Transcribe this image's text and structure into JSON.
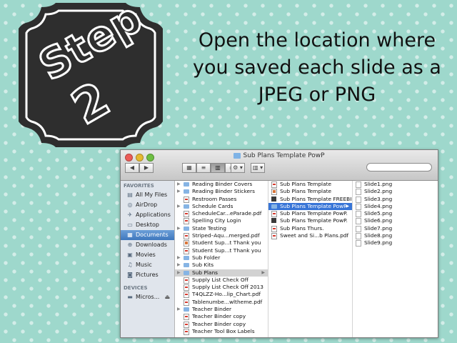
{
  "badge": {
    "line1": "Step",
    "line2": "2"
  },
  "instruction": [
    "Open the location where",
    "you saved each slide as a",
    "JPEG or PNG"
  ],
  "finder": {
    "title": "Sub Plans Template PowP",
    "nav_back": "◀",
    "nav_fwd": "▶",
    "search_placeholder": "",
    "sidebar": {
      "favorites_heading": "FAVORITES",
      "favorites": [
        {
          "label": "All My Files",
          "icon": "all-files-icon",
          "glyph": "▤"
        },
        {
          "label": "AirDrop",
          "icon": "airdrop-icon",
          "glyph": "◎"
        },
        {
          "label": "Applications",
          "icon": "applications-icon",
          "glyph": "✈"
        },
        {
          "label": "Desktop",
          "icon": "desktop-icon",
          "glyph": "▭"
        },
        {
          "label": "Documents",
          "icon": "documents-icon",
          "glyph": "▦",
          "selected": true
        },
        {
          "label": "Downloads",
          "icon": "downloads-icon",
          "glyph": "⊕"
        },
        {
          "label": "Movies",
          "icon": "movies-icon",
          "glyph": "▣"
        },
        {
          "label": "Music",
          "icon": "music-icon",
          "glyph": "♫"
        },
        {
          "label": "Pictures",
          "icon": "pictures-icon",
          "glyph": "◙"
        }
      ],
      "devices_heading": "DEVICES",
      "devices": [
        {
          "label": "Micros...",
          "icon": "disk-icon",
          "glyph": "▬"
        }
      ],
      "eject": "⏏"
    },
    "col1": [
      {
        "label": "Reading Binder Covers",
        "type": "folder",
        "disc": true
      },
      {
        "label": "Reading Binder Stickers",
        "type": "folder",
        "disc": true
      },
      {
        "label": "Restroom Passes",
        "type": "pdf"
      },
      {
        "label": "Schedule Cards",
        "type": "folder",
        "disc": true
      },
      {
        "label": "ScheduleCar...eParade.pdf",
        "type": "pdf"
      },
      {
        "label": "Spelling City Login",
        "type": "pdf"
      },
      {
        "label": "State Testing",
        "type": "folder",
        "disc": true
      },
      {
        "label": "Striped–Aqu...merged.pdf",
        "type": "pdf"
      },
      {
        "label": "Student Sup...t Thank you",
        "type": "ppt"
      },
      {
        "label": "Student Sup...t Thank you",
        "type": "pdf"
      },
      {
        "label": "Sub Folder",
        "type": "folder",
        "disc": true
      },
      {
        "label": "Sub Kits",
        "type": "folder",
        "disc": true
      },
      {
        "label": "Sub Plans",
        "type": "folder",
        "disc": true,
        "arrow": true,
        "selected": "gray"
      },
      {
        "label": "Supply List Check Off",
        "type": "pdf"
      },
      {
        "label": "Supply List Check Off 2013",
        "type": "pdf"
      },
      {
        "label": "T4QLZZ-Ho...lip_Chart.pdf",
        "type": "pdf"
      },
      {
        "label": "Tablenumbe...wltheme.pdf",
        "type": "pdf"
      },
      {
        "label": "Teacher Binder",
        "type": "folder",
        "disc": true
      },
      {
        "label": "Teacher Binder copy",
        "type": "pdf"
      },
      {
        "label": "Teacher Binder copy",
        "type": "pdf"
      },
      {
        "label": "Teacher Tool Box Labels",
        "type": "pdf"
      }
    ],
    "col2": [
      {
        "label": "Sub Plans Template",
        "type": "pdf"
      },
      {
        "label": "Sub Plans Template",
        "type": "ppt"
      },
      {
        "label": "Sub Plans Template FREEBIE",
        "type": "pptx"
      },
      {
        "label": "Sub Plans Template PowP",
        "type": "folder",
        "arrow": true,
        "selected": "blue"
      },
      {
        "label": "Sub Plans Template PowP.",
        "type": "pdf"
      },
      {
        "label": "Sub Plans Template PowP.",
        "type": "pptx"
      },
      {
        "label": "Sub Plans Thurs.",
        "type": "pdf"
      },
      {
        "label": "Sweet and Si...b Plans.pdf",
        "type": "pdf"
      }
    ],
    "col3": [
      {
        "label": "Slide1.png",
        "type": "png"
      },
      {
        "label": "Slide2.png",
        "type": "png"
      },
      {
        "label": "Slide3.png",
        "type": "png"
      },
      {
        "label": "Slide4.png",
        "type": "png"
      },
      {
        "label": "Slide5.png",
        "type": "png"
      },
      {
        "label": "Slide6.png",
        "type": "png"
      },
      {
        "label": "Slide7.png",
        "type": "png"
      },
      {
        "label": "Slide8.png",
        "type": "png"
      },
      {
        "label": "Slide9.png",
        "type": "png"
      }
    ]
  }
}
